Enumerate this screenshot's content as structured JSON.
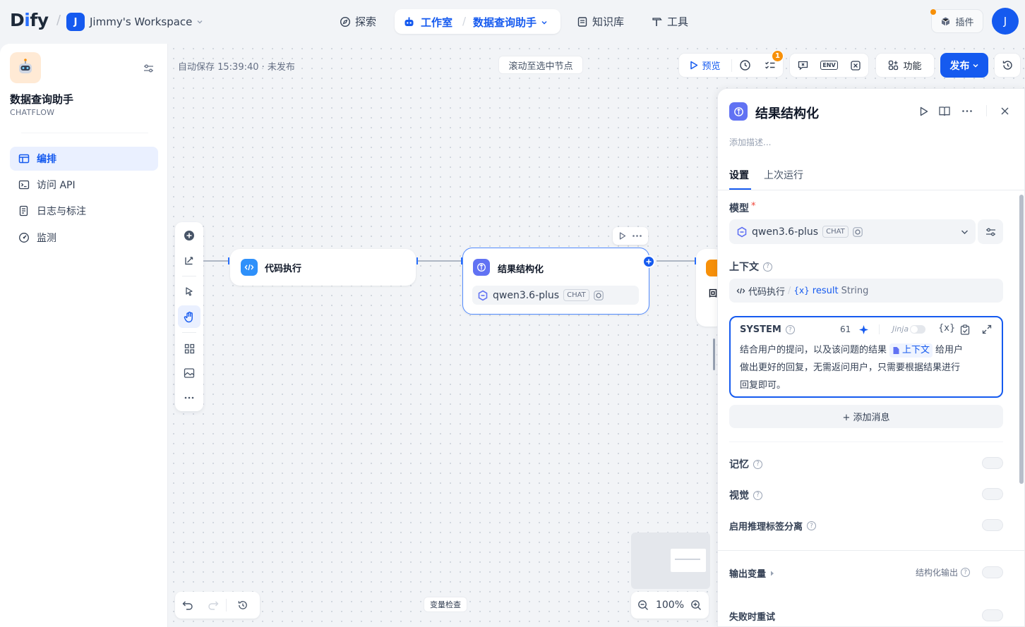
{
  "topbar": {
    "logo": "Dify",
    "workspace_initial": "J",
    "workspace_name": "Jimmy's Workspace",
    "nav_explore": "探索",
    "nav_studio": "工作室",
    "nav_app": "数据查询助手",
    "nav_knowledge": "知识库",
    "nav_tools": "工具",
    "plugins": "插件",
    "avatar_initial": "J"
  },
  "sidebar": {
    "app_name": "数据查询助手",
    "app_type": "CHATFLOW",
    "items": [
      {
        "label": "编排",
        "icon": "layout-icon",
        "active": true
      },
      {
        "label": "访问 API",
        "icon": "terminal-icon",
        "active": false
      },
      {
        "label": "日志与标注",
        "icon": "document-list-icon",
        "active": false
      },
      {
        "label": "监测",
        "icon": "gauge-icon",
        "active": false
      }
    ]
  },
  "canvas": {
    "autosave": "自动保存 15:39:40 · 未发布",
    "scroll_to_selected": "滚动至选中节点",
    "toolbar": {
      "preview": "预览",
      "checklist_count": "1",
      "features": "功能",
      "publish": "发布",
      "env": "ENV"
    },
    "nodes": {
      "code": {
        "title": "代码执行"
      },
      "llm": {
        "title": "结果结构化",
        "model": "qwen3.6-plus",
        "model_tag": "CHAT"
      },
      "next_partial": {
        "title": "回"
      }
    },
    "variable_inspect": "变量检查",
    "zoom": "100%"
  },
  "panel": {
    "title": "结果结构化",
    "description_placeholder": "添加描述...",
    "tabs": [
      "设置",
      "上次运行"
    ],
    "model_label": "模型",
    "required_mark": "*",
    "model_name": "qwen3.6-plus",
    "model_tag": "CHAT",
    "context_label": "上下文",
    "context_node": "代码执行",
    "context_var_prefix": "{x}",
    "context_var": "result",
    "context_type": "String",
    "system_label": "SYSTEM",
    "char_count": "61",
    "jinja_label": "Jinja",
    "prompt_part1": "结合用户的提问，以及该问题的结果",
    "prompt_ctx": "上下文",
    "prompt_part2": "给用户",
    "prompt_line2": "做出更好的回复，无需返问用户，只需要根据结果进行",
    "prompt_line3": "回复即可。",
    "add_message": "+ 添加消息",
    "memory_label": "记忆",
    "vision_label": "视觉",
    "reasoning_label": "启用推理标签分离",
    "output_label": "输出变量",
    "structured_output": "结构化输出",
    "retry_label": "失败时重试"
  },
  "colors": {
    "accent": "#155aef",
    "badge": "#f79009",
    "llm_icon": "#6172f3",
    "code_icon": "#2e90fa"
  }
}
